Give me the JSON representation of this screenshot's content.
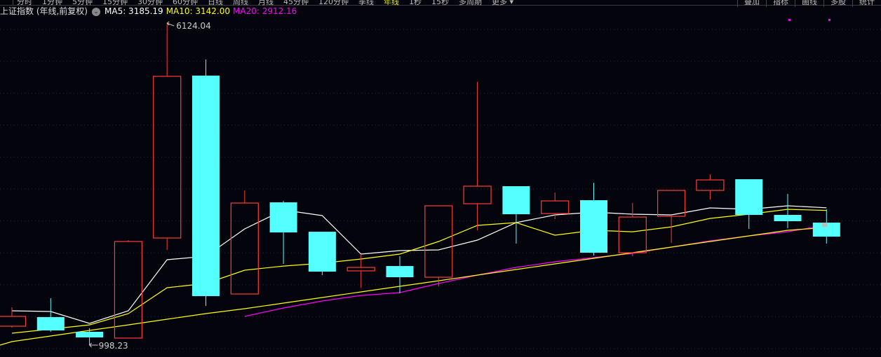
{
  "toolbar": {
    "tabs": [
      "分时",
      "1分钟",
      "5分钟",
      "15分钟",
      "30分钟",
      "60分钟",
      "日线",
      "周线",
      "月线",
      "45分钟",
      "120分钟",
      "季线",
      "年线",
      "1秒",
      "15秒",
      "多周期",
      "更多 ▾"
    ],
    "active_tab": 12,
    "right_buttons": [
      "叠加",
      "指标",
      "画线",
      "多股",
      "统计"
    ]
  },
  "legend": {
    "title": "上证指数 (年线,前复权)",
    "ma5": "MA5: 3185.19",
    "ma10": "MA10: 3142.00",
    "ma20": "MA20: 2912.16"
  },
  "colors": {
    "up": "#ff3b3b",
    "down": "#54ffff",
    "ma5": "#ffffff",
    "ma10": "#ffff00",
    "ma20": "#ff00ff",
    "bg": "#04040c"
  },
  "chart_data": {
    "type": "candlestick",
    "title": "上证指数 (年线,前复权)",
    "ylim": [
      809,
      6247
    ],
    "grid": true,
    "candles": [
      {
        "o": 1299,
        "h": 1600,
        "l": 1277,
        "c": 1455
      },
      {
        "o": 1444,
        "h": 1745,
        "l": 1210,
        "c": 1232
      },
      {
        "o": 1210,
        "h": 1266,
        "l": 998.23,
        "c": 1121
      },
      {
        "o": 1110,
        "h": 2670,
        "l": 1110,
        "c": 2648
      },
      {
        "o": 2703,
        "h": 6124.04,
        "l": 2514,
        "c": 5277
      },
      {
        "o": 5288,
        "h": 5545,
        "l": 1622,
        "c": 1778
      },
      {
        "o": 1812,
        "h": 3461,
        "l": 1812,
        "c": 3260
      },
      {
        "o": 3271,
        "h": 3294,
        "l": 2291,
        "c": 2792
      },
      {
        "o": 2803,
        "h": 2803,
        "l": 2113,
        "c": 2168
      },
      {
        "o": 2180,
        "h": 2447,
        "l": 1912,
        "c": 2235
      },
      {
        "o": 2257,
        "h": 2413,
        "l": 1823,
        "c": 2079
      },
      {
        "o": 2079,
        "h": 3216,
        "l": 1934,
        "c": 3216
      },
      {
        "o": 3249,
        "h": 5188,
        "l": 2826,
        "c": 3528
      },
      {
        "o": 3528,
        "h": 3528,
        "l": 2614,
        "c": 3082
      },
      {
        "o": 3093,
        "h": 3427,
        "l": 3004,
        "c": 3294
      },
      {
        "o": 3305,
        "h": 3583,
        "l": 2425,
        "c": 2469
      },
      {
        "o": 2469,
        "h": 3260,
        "l": 2413,
        "c": 3037
      },
      {
        "o": 3049,
        "h": 3461,
        "l": 2625,
        "c": 3461
      },
      {
        "o": 3461,
        "h": 3717,
        "l": 3316,
        "c": 3628
      },
      {
        "o": 3639,
        "h": 3639,
        "l": 2848,
        "c": 3071
      },
      {
        "o": 3071,
        "h": 3405,
        "l": 2859,
        "c": 2971
      },
      {
        "o": 2948,
        "h": 3160,
        "l": 2614,
        "c": 2725
      }
    ],
    "series": [
      {
        "name": "MA5",
        "color": "#ffffff",
        "start": 0,
        "values": [
          1544,
          1533,
          1344,
          1544,
          2358,
          2413,
          2848,
          3149,
          3060,
          2447,
          2503,
          2514,
          2670,
          2948,
          3071,
          3115,
          3082,
          3071,
          3182,
          3160,
          3216,
          3185.19
        ]
      },
      {
        "name": "MA10",
        "color": "#ffff00",
        "start": 0,
        "values": [
          1188,
          1254,
          1321,
          1499,
          1912,
          1979,
          2191,
          2257,
          2302,
          2369,
          2447,
          2648,
          2904,
          2948,
          2748,
          2826,
          2803,
          2881,
          3015,
          3082,
          3160,
          3142.0
        ]
      },
      {
        "name": "MA20",
        "color": "#ff00ff",
        "start": 6,
        "values": [
          1455,
          1589,
          1700,
          1789,
          1834,
          1979,
          2113,
          2235,
          2324,
          2391,
          2458,
          2558,
          2659,
          2737,
          2803,
          2912.16
        ]
      },
      {
        "name": "MA-long",
        "color": "#ffff00",
        "start": 0,
        "values": [
          1054,
          1143,
          1232,
          1321,
          1411,
          1500,
          1578,
          1667,
          1756,
          1845,
          1934,
          2023,
          2113,
          2202,
          2291,
          2380,
          2469,
          2558,
          2648,
          2737,
          2826,
          2870
        ]
      }
    ],
    "annotations": {
      "high": "6124.04",
      "low": "998.23"
    }
  }
}
